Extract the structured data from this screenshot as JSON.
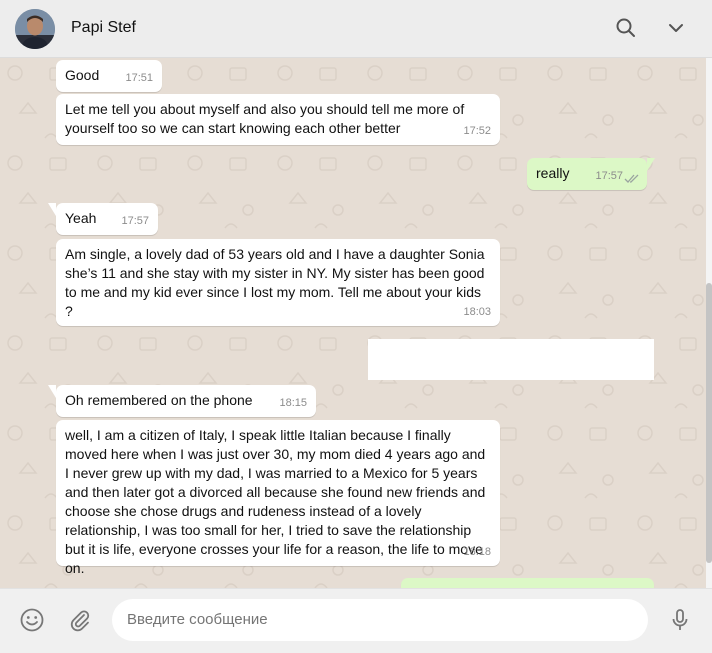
{
  "header": {
    "contact_name": "Papi Stef",
    "icons": [
      "search-icon",
      "chevron-down-icon"
    ]
  },
  "messages": [
    {
      "direction": "in",
      "text": "Good",
      "time": "17:51"
    },
    {
      "direction": "in",
      "text": "Let me tell you about myself and also you should tell me more of yourself too so we can start knowing each other better",
      "time": "17:52"
    },
    {
      "direction": "out",
      "text": "really",
      "time": "17:57",
      "status": "read"
    },
    {
      "direction": "in",
      "text": "Yeah",
      "time": "17:57"
    },
    {
      "direction": "in",
      "text": "Am single, a lovely dad of 53 years old and I have a daughter Sonia she’s 11 and she stay with my sister in NY. My sister has been good to me and my kid  ever since I lost my mom. Tell me about your kids ?",
      "time": "18:03"
    },
    {
      "direction": "in",
      "text": "Oh remembered on the phone",
      "time": "18:15"
    },
    {
      "direction": "in",
      "text": "well, I am a citizen of Italy, I speak little Italian because I finally moved here when I was just over 30, my mom died 4 years ago and I never grew up with my dad, I was married to a Mexico for 5 years and then later got a divorced all because she found new friends and choose she chose drugs and rudeness instead of a lovely relationship, I was too small for her, I tried to save the relationship but it is life, everyone crosses your life for a reason, the  life to move on.",
      "time": "18:18"
    }
  ],
  "footer": {
    "placeholder": "Введите сообщение",
    "icons": [
      "emoji-icon",
      "attach-icon",
      "microphone-icon"
    ]
  },
  "colors": {
    "chat_background": "#e6ddd4",
    "incoming_bubble": "#ffffff",
    "outgoing_bubble": "#dcf8c6",
    "read_ticks": "#4fc3f7"
  }
}
